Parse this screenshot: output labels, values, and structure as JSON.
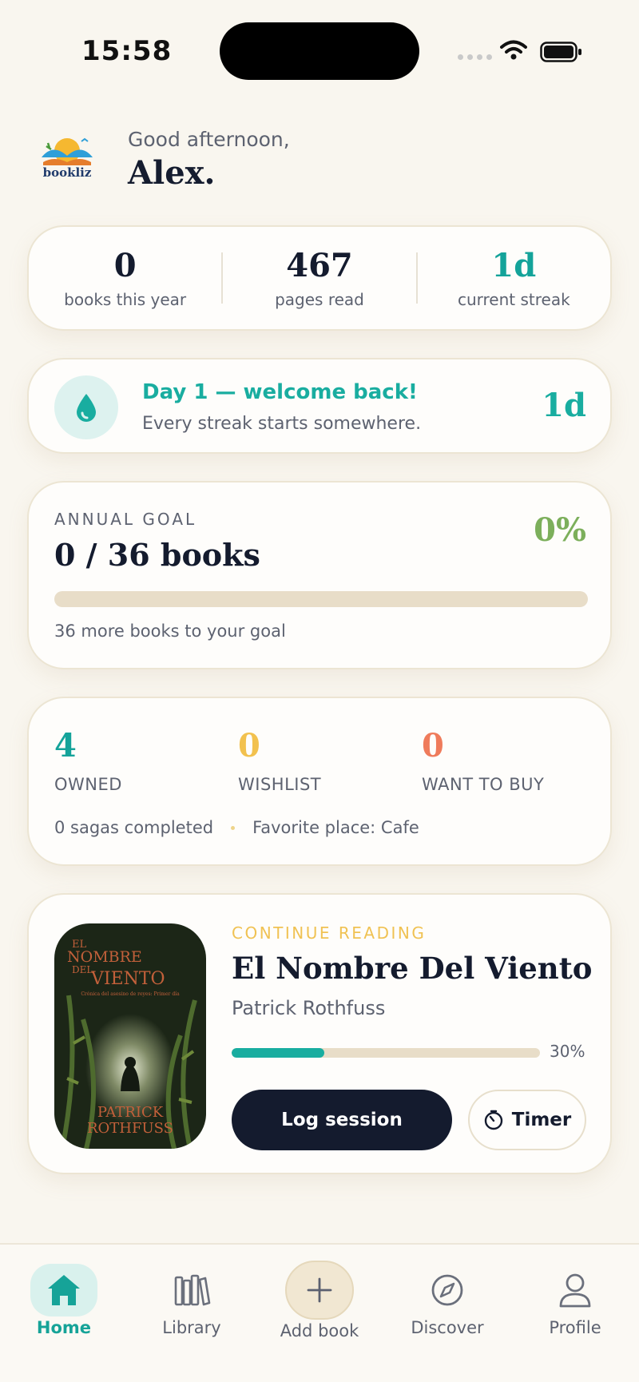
{
  "status_bar": {
    "time": "15:58"
  },
  "header": {
    "logo_text": "bookliz",
    "greeting": "Good afternoon,",
    "user_name": "Alex."
  },
  "stats": [
    {
      "value": "0",
      "label": "books this year"
    },
    {
      "value": "467",
      "label": "pages read"
    },
    {
      "value": "1d",
      "label": "current streak"
    }
  ],
  "streak": {
    "title": "Day 1 — welcome back!",
    "subtitle": "Every streak starts somewhere.",
    "value": "1d"
  },
  "goal": {
    "label": "ANNUAL GOAL",
    "value": "0 / 36 books",
    "percent": "0%",
    "progress": 0,
    "subtitle": "36 more books to your goal"
  },
  "collection": {
    "items": [
      {
        "value": "4",
        "label": "OWNED",
        "color": "#14a39a"
      },
      {
        "value": "0",
        "label": "WISHLIST",
        "color": "#f2c14e"
      },
      {
        "value": "0",
        "label": "WANT TO BUY",
        "color": "#ef7b5b"
      }
    ],
    "sagas": "0 sagas completed",
    "favorite_place": "Favorite place: Cafe"
  },
  "reading": {
    "label": "CONTINUE READING",
    "title": "El Nombre Del Viento",
    "author": "Patrick Rothfuss",
    "progress": 0.3,
    "percent": "30%",
    "cover_title_lines": [
      "EL",
      "NOMBRE",
      "DEL",
      "VIENTO"
    ],
    "cover_subtitle": "Crónica del asesino de reyes: Primer día",
    "cover_author_lines": [
      "PATRICK",
      "ROTHFUSS"
    ],
    "log_label": "Log session",
    "timer_label": "Timer"
  },
  "nav": [
    {
      "label": "Home",
      "icon": "home-icon",
      "active": true
    },
    {
      "label": "Library",
      "icon": "library-icon",
      "active": false
    },
    {
      "label": "Add book",
      "icon": "plus-icon",
      "active": false
    },
    {
      "label": "Discover",
      "icon": "compass-icon",
      "active": false
    },
    {
      "label": "Profile",
      "icon": "profile-icon",
      "active": false
    }
  ],
  "colors": {
    "background": "#f9f6ef",
    "teal": "#14a39a",
    "yellow": "#f2c14e",
    "coral": "#ef7b5b",
    "green": "#7caf5b",
    "navy": "#141b2e"
  }
}
